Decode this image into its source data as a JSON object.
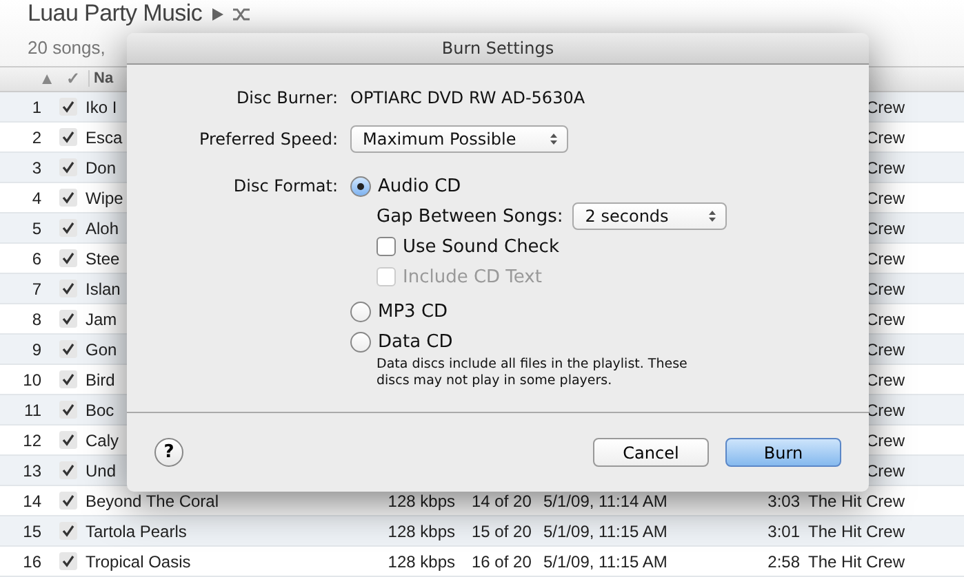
{
  "playlist": {
    "title": "Luau Party Music",
    "subtitle": "20 songs,"
  },
  "table": {
    "columns": [
      {
        "label": "▲"
      },
      {
        "label": "✓"
      },
      {
        "label": "Na"
      }
    ],
    "rows": [
      {
        "number": "1",
        "checked": true,
        "name": "Iko I",
        "artist": "Crew"
      },
      {
        "number": "2",
        "checked": true,
        "name": "Esca",
        "artist": "Crew"
      },
      {
        "number": "3",
        "checked": true,
        "name": "Don",
        "artist": "Crew"
      },
      {
        "number": "4",
        "checked": true,
        "name": "Wipe",
        "artist": "Crew"
      },
      {
        "number": "5",
        "checked": true,
        "name": "Aloh",
        "artist": "Crew"
      },
      {
        "number": "6",
        "checked": true,
        "name": "Stee",
        "artist": "Crew"
      },
      {
        "number": "7",
        "checked": true,
        "name": "Islan",
        "artist": "Crew"
      },
      {
        "number": "8",
        "checked": true,
        "name": "Jam",
        "artist": "Crew"
      },
      {
        "number": "9",
        "checked": true,
        "name": "Gon",
        "artist": "Crew"
      },
      {
        "number": "10",
        "checked": true,
        "name": "Bird",
        "artist": "Crew"
      },
      {
        "number": "11",
        "checked": true,
        "name": "Boc",
        "artist": "Crew"
      },
      {
        "number": "12",
        "checked": true,
        "name": "Caly",
        "artist": "Crew"
      },
      {
        "number": "13",
        "checked": true,
        "name": "Und",
        "artist": "Crew"
      },
      {
        "number": "14",
        "checked": true,
        "name": "Beyond The Coral",
        "bitrate": "128 kbps",
        "track": "14 of 20",
        "date": "5/1/09, 11:14 AM",
        "time": "3:03",
        "artist": "The Hit Crew"
      },
      {
        "number": "15",
        "checked": true,
        "name": "Tartola Pearls",
        "bitrate": "128 kbps",
        "track": "15 of 20",
        "date": "5/1/09, 11:15 AM",
        "time": "3:01",
        "artist": "The Hit Crew"
      },
      {
        "number": "16",
        "checked": true,
        "name": "Tropical Oasis",
        "bitrate": "128 kbps",
        "track": "16 of 20",
        "date": "5/1/09, 11:15 AM",
        "time": "2:58",
        "artist": "The Hit Crew"
      }
    ]
  },
  "dialog": {
    "title": "Burn Settings",
    "disc_burner": {
      "label": "Disc Burner:",
      "value": "OPTIARC DVD RW AD-5630A"
    },
    "preferred_speed": {
      "label": "Preferred Speed:",
      "value": "Maximum Possible"
    },
    "disc_format": {
      "label": "Disc Format:",
      "options": [
        {
          "label": "Audio CD",
          "selected": true
        },
        {
          "label": "MP3 CD",
          "selected": false
        },
        {
          "label": "Data CD",
          "selected": false,
          "note": "Data discs include all files in the playlist.  These discs may not play in some players."
        }
      ]
    },
    "gap": {
      "label": "Gap Between Songs:",
      "value": "2 seconds"
    },
    "checkboxes": [
      {
        "label": "Use Sound Check",
        "checked": false,
        "disabled": false
      },
      {
        "label": "Include CD Text",
        "checked": false,
        "disabled": true
      }
    ],
    "help": "?",
    "buttons": [
      {
        "label": "Cancel",
        "default": false
      },
      {
        "label": "Burn",
        "default": true
      }
    ]
  }
}
